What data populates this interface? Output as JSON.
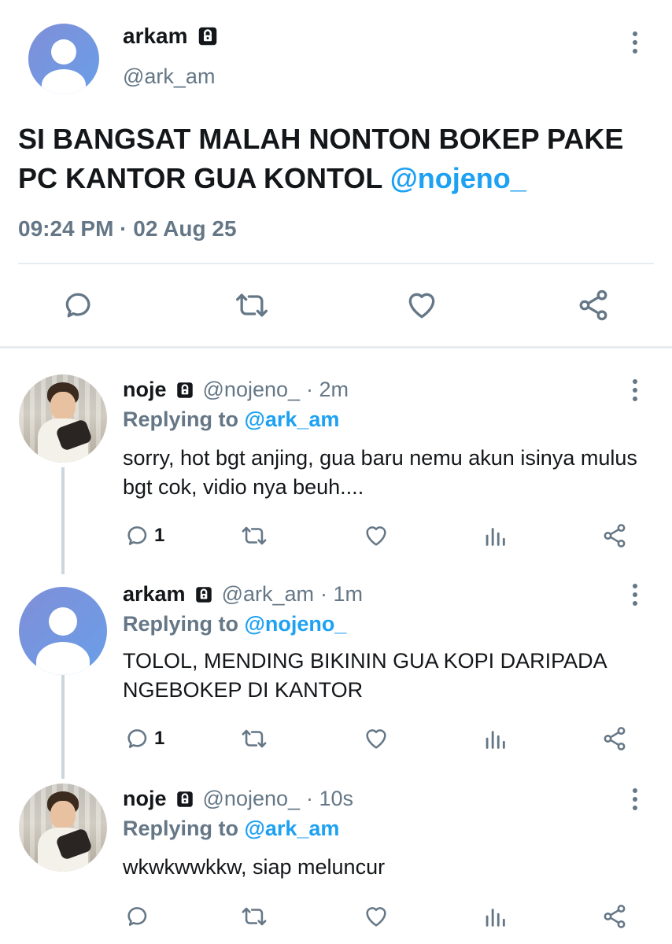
{
  "main_tweet": {
    "name": "arkam",
    "handle": "@ark_am",
    "text": "SI BANGSAT MALAH NONTON BOKEP PAKE PC KANTOR GUA KONTOL ",
    "mention": "@nojeno_",
    "timestamp": "09:24 PM · 02 Aug 25"
  },
  "replies": [
    {
      "name": "noje",
      "handle": "@nojeno_",
      "time": "· 2m",
      "replying_label": "Replying to ",
      "replying_to": "@ark_am",
      "text": "sorry, hot bgt anjing, gua baru nemu akun isinya mulus bgt cok, vidio nya beuh....",
      "reply_count": "1"
    },
    {
      "name": "arkam",
      "handle": "@ark_am",
      "time": "· 1m",
      "replying_label": "Replying to ",
      "replying_to": "@nojeno_",
      "text": "TOLOL, MENDING BIKININ GUA KOPI DARIPADA NGEBOKEP DI KANTOR",
      "reply_count": "1"
    },
    {
      "name": "noje",
      "handle": "@nojeno_",
      "time": "· 10s",
      "replying_label": "Replying to ",
      "replying_to": "@ark_am",
      "text": "wkwkwwkkw, siap meluncur",
      "reply_count": ""
    }
  ],
  "icons": {
    "reply": "comment-icon",
    "retweet": "retweet-icon",
    "like": "heart-icon",
    "analytics": "analytics-icon",
    "share": "share-icon",
    "lock": "lock-icon",
    "more": "more-vertical-icon"
  },
  "colors": {
    "link": "#1da1f2",
    "secondary_text": "#657786",
    "primary_text": "#14171a",
    "divider": "#e6ecf0"
  }
}
